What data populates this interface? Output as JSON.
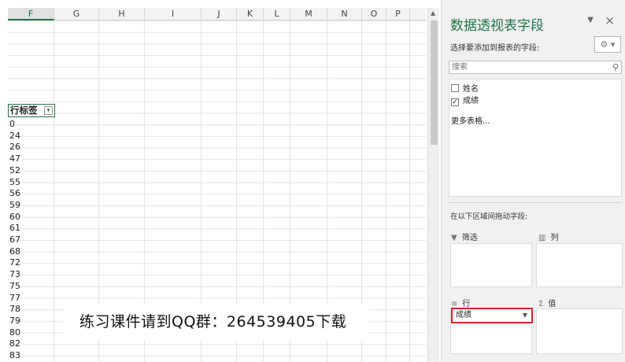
{
  "sheet": {
    "columns": [
      "F",
      "G",
      "H",
      "I",
      "J",
      "K",
      "L",
      "M",
      "N",
      "O",
      "P"
    ],
    "selected_column": "F",
    "pivot_header": "行标签",
    "pivot_filter_icon": "dropdown-filter-icon",
    "row_values": [
      "0",
      "24",
      "26",
      "47",
      "52",
      "55",
      "56",
      "59",
      "60",
      "61",
      "67",
      "68",
      "72",
      "73",
      "75",
      "77",
      "78",
      "79",
      "80",
      "82",
      "83"
    ]
  },
  "panel": {
    "title": "数据透视表字段",
    "subtitle": "选择要添加到报表的字段:",
    "gear_icon": "gear-icon",
    "search_placeholder": "搜索",
    "fields": [
      {
        "label": "姓名",
        "checked": false
      },
      {
        "label": "成绩",
        "checked": true
      }
    ],
    "more_tables": "更多表格...",
    "drag_hint": "在以下区域间拖动字段:",
    "areas": {
      "filters": {
        "label": "筛选",
        "glyph": "▼"
      },
      "columns": {
        "label": "列",
        "glyph": "▥"
      },
      "rows": {
        "label": "行",
        "glyph": "≡"
      },
      "values": {
        "label": "值",
        "glyph": "Σ"
      }
    },
    "row_item": "成绩"
  },
  "watermark": "练习课件请到QQ群：264539405下载",
  "colors": {
    "accent": "#217346",
    "highlight_border": "#e0232a"
  }
}
